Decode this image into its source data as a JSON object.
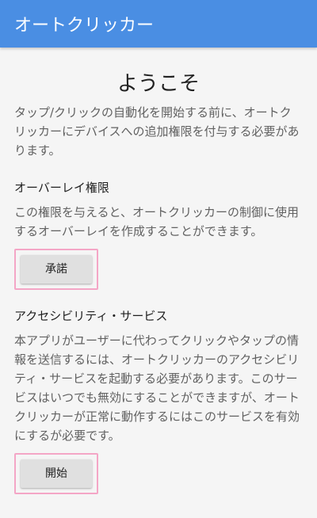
{
  "appbar": {
    "title": "オートクリッカー"
  },
  "main": {
    "welcome_title": "ようこそ",
    "intro": "タップ/クリックの自動化を開始する前に、オートクリッカーにデバイスへの追加権限を付与する必要があります。"
  },
  "overlay": {
    "title": "オーバーレイ権限",
    "body": "この権限を与えると、オートクリッカーの制御に使用するオーバーレイを作成することができます。",
    "button_label": "承諾"
  },
  "accessibility": {
    "title": "アクセシビリティ・サービス",
    "body": "本アプリがユーザーに代わってクリックやタップの情報を送信するには、オートクリッカーのアクセシビリティ・サービスを起動する必要があります。このサービスはいつでも無効にすることができますが、オートクリッカーが正常に動作するにはこのサービスを有効にするが必要です。",
    "button_label": "開始"
  },
  "colors": {
    "appbar": "#4a8ee3",
    "highlight_border": "#f4a6c6",
    "button_bg": "#e0e0e0"
  }
}
